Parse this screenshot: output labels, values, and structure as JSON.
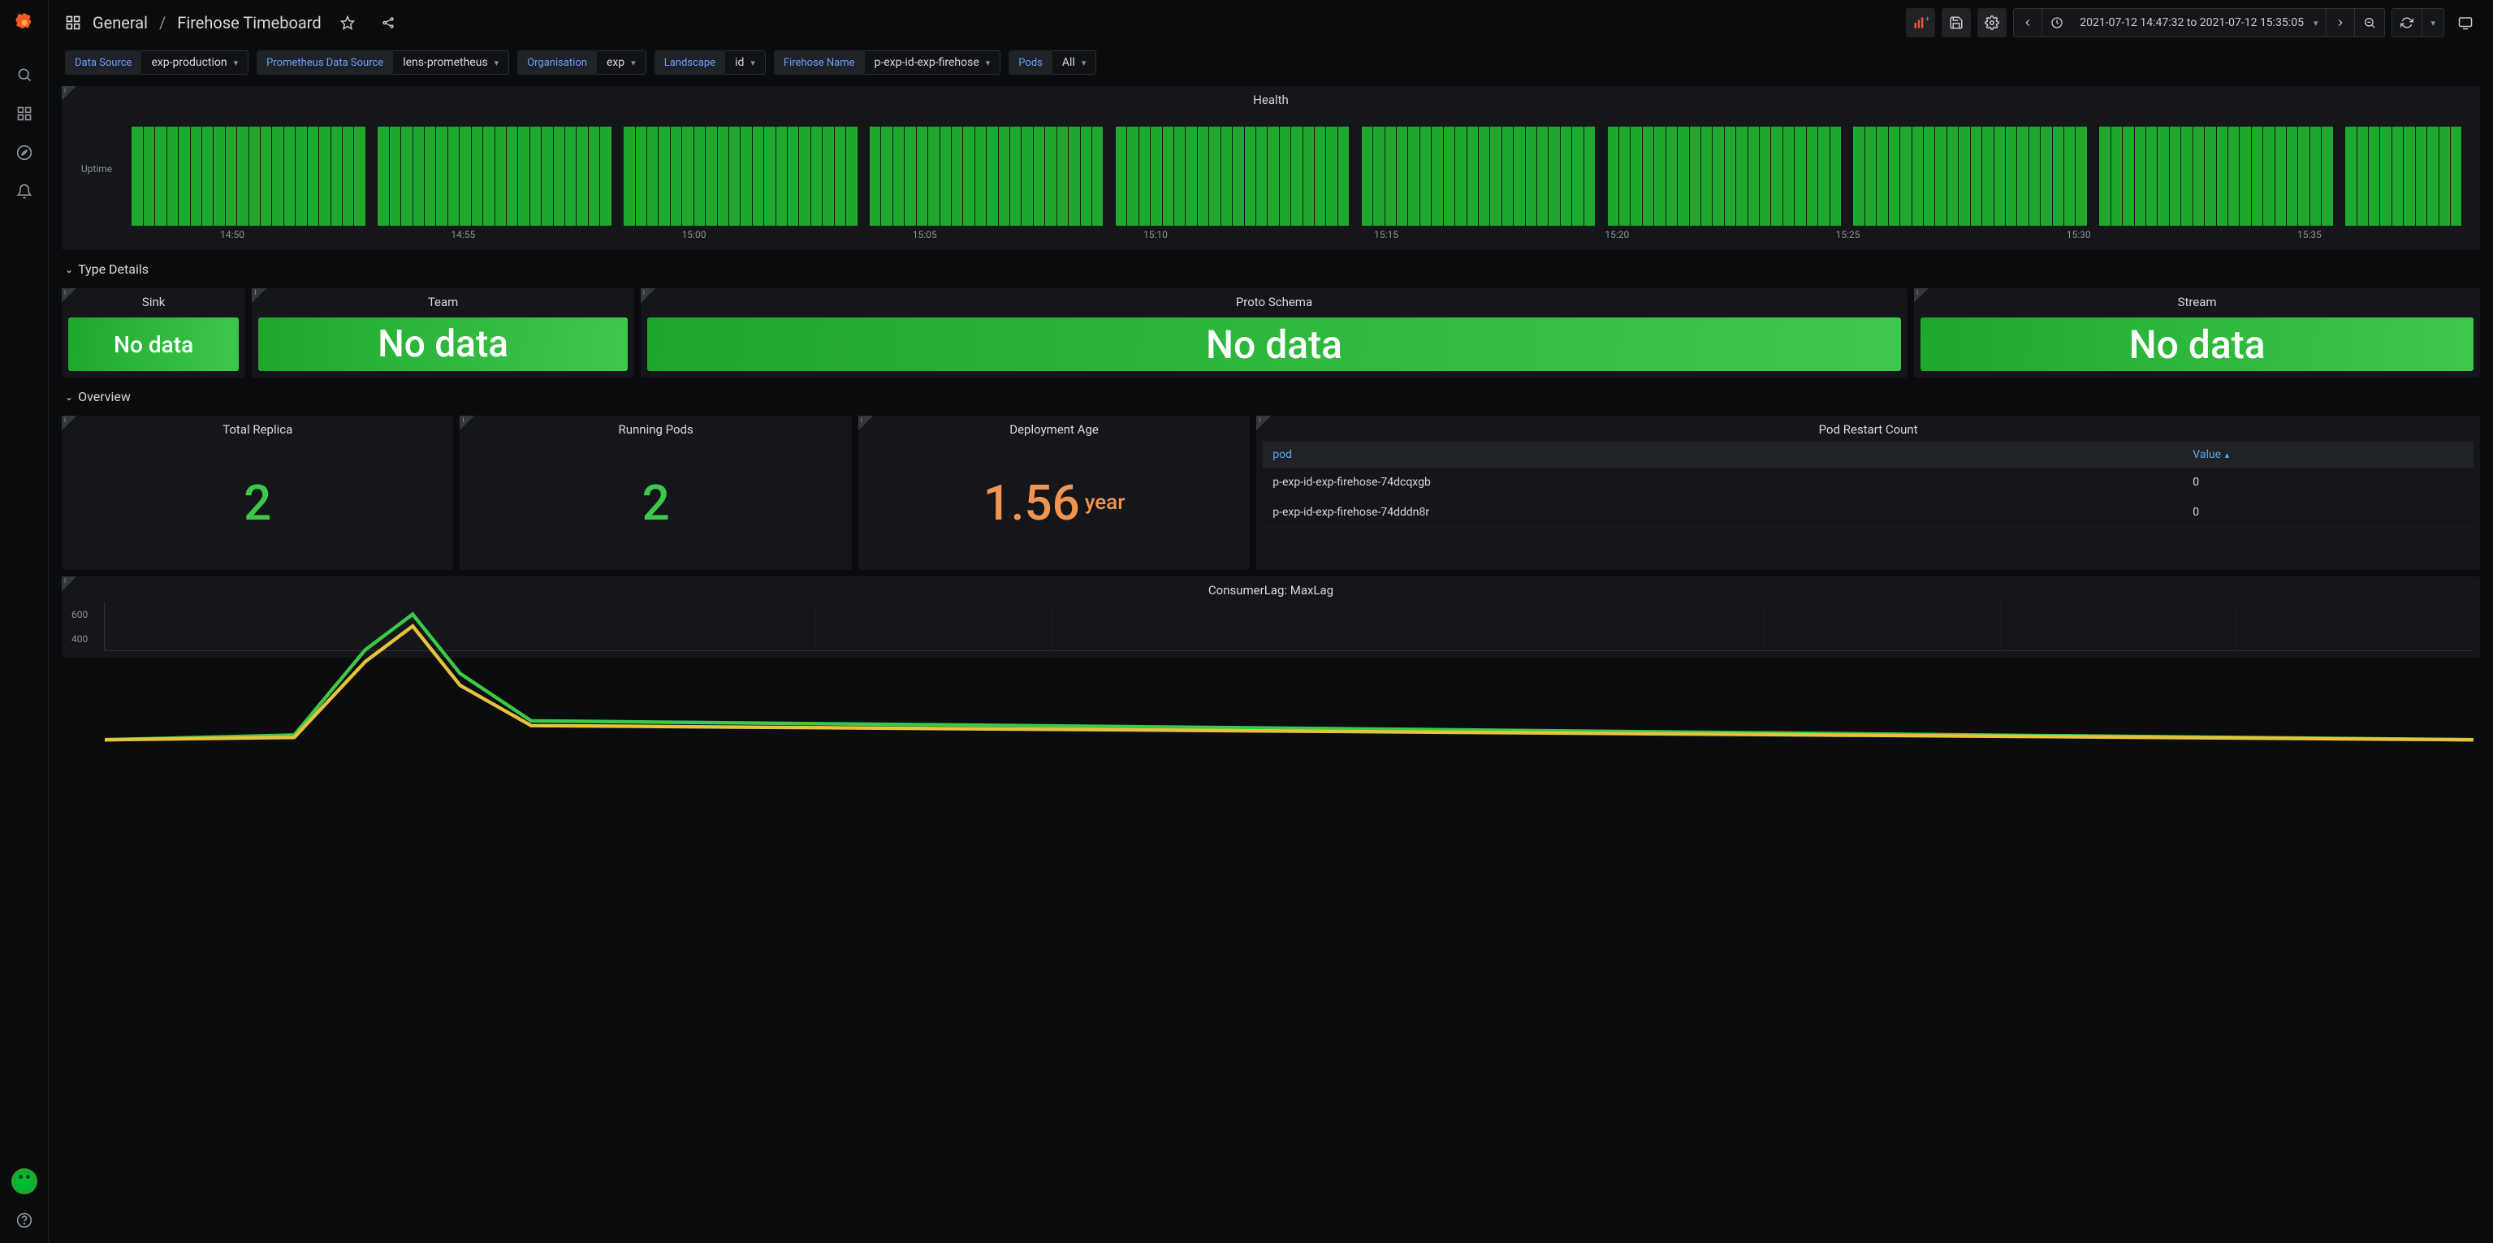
{
  "breadcrumb": {
    "folder": "General",
    "dashboard": "Firehose Timeboard"
  },
  "time_range": "2021-07-12 14:47:32 to 2021-07-12 15:35:05",
  "vars": [
    {
      "label": "Data Source",
      "value": "exp-production"
    },
    {
      "label": "Prometheus Data Source",
      "value": "lens-prometheus"
    },
    {
      "label": "Organisation",
      "value": "exp"
    },
    {
      "label": "Landscape",
      "value": "id"
    },
    {
      "label": "Firehose Name",
      "value": "p-exp-id-exp-firehose"
    },
    {
      "label": "Pods",
      "value": "All"
    }
  ],
  "panels": {
    "health": {
      "title": "Health",
      "ylabel": "Uptime",
      "xticks": [
        "14:50",
        "14:55",
        "15:00",
        "15:05",
        "15:10",
        "15:15",
        "15:20",
        "15:25",
        "15:30",
        "15:35"
      ]
    },
    "type_row": "Type Details",
    "type": {
      "sink": {
        "title": "Sink",
        "value": "No data"
      },
      "team": {
        "title": "Team",
        "value": "No data"
      },
      "proto": {
        "title": "Proto Schema",
        "value": "No data"
      },
      "stream": {
        "title": "Stream",
        "value": "No data"
      }
    },
    "overview_row": "Overview",
    "overview": {
      "replica": {
        "title": "Total Replica",
        "value": "2"
      },
      "running": {
        "title": "Running Pods",
        "value": "2"
      },
      "age": {
        "title": "Deployment Age",
        "value": "1.56",
        "unit": "year"
      },
      "restarts": {
        "title": "Pod Restart Count",
        "col_pod": "pod",
        "col_val": "Value",
        "rows": [
          {
            "pod": "p-exp-id-exp-firehose-74dcqxgb",
            "value": "0"
          },
          {
            "pod": "p-exp-id-exp-firehose-74dddn8r",
            "value": "0"
          }
        ]
      }
    },
    "lag": {
      "title": "ConsumerLag: MaxLag",
      "yticks": [
        "600",
        "400"
      ]
    }
  },
  "chart_data": [
    {
      "type": "bar",
      "title": "Health",
      "ylabel": "Uptime",
      "xticks": [
        "14:50",
        "14:55",
        "15:00",
        "15:05",
        "15:10",
        "15:15",
        "15:20",
        "15:25",
        "15:30",
        "15:35"
      ],
      "note": "Dense green uptime bars across full range with periodic small gaps"
    },
    {
      "type": "line",
      "title": "ConsumerLag: MaxLag",
      "yticks": [
        400,
        600
      ],
      "note": "Two series (green, yellow) near zero with a spike around x≈12% reaching ~600"
    }
  ]
}
